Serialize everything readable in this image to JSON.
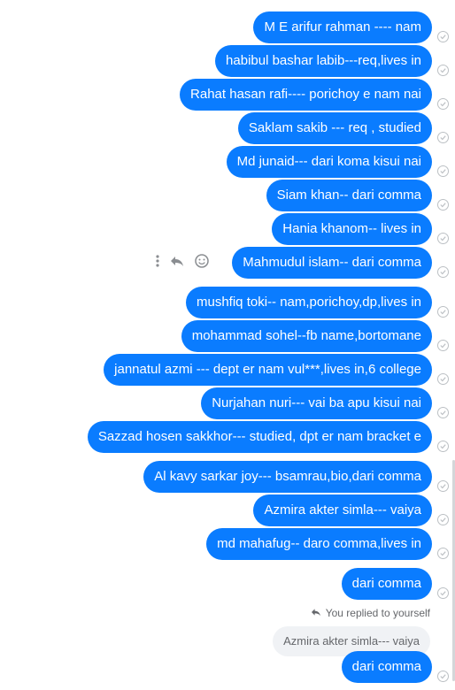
{
  "messages": [
    {
      "text": "M E arifur rahman ---- nam"
    },
    {
      "text": "habibul bashar labib---req,lives in"
    },
    {
      "text": "Rahat hasan rafi---- porichoy e nam nai"
    },
    {
      "text": "Saklam sakib --- req , studied"
    },
    {
      "text": "Md junaid--- dari koma kisui nai"
    },
    {
      "text": "Siam khan-- dari comma"
    },
    {
      "text": "Hania khanom-- lives in"
    },
    {
      "text": "Mahmudul islam-- dari comma"
    },
    {
      "text": "mushfiq toki-- nam,porichoy,dp,lives in"
    },
    {
      "text": "mohammad sohel--fb name,bortomane"
    },
    {
      "text": "jannatul azmi --- dept er nam vul***,lives in,6 college"
    },
    {
      "text": "Nurjahan nuri--- vai ba apu kisui nai"
    },
    {
      "text": "Sazzad hosen sakkhor--- studied, dpt er nam bracket e"
    },
    {
      "text": "Al kavy sarkar joy--- bsamrau,bio,dari comma"
    },
    {
      "text": "Azmira akter simla--- vaiya"
    },
    {
      "text": "md mahafug-- daro comma,lives in"
    },
    {
      "text": "dari comma"
    }
  ],
  "reply": {
    "label": "You replied to yourself",
    "quoted": "Azmira akter simla--- vaiya",
    "text": "dari comma"
  },
  "colors": {
    "bubble": "#0a7cff",
    "quoted_bg": "#f0f2f5"
  }
}
